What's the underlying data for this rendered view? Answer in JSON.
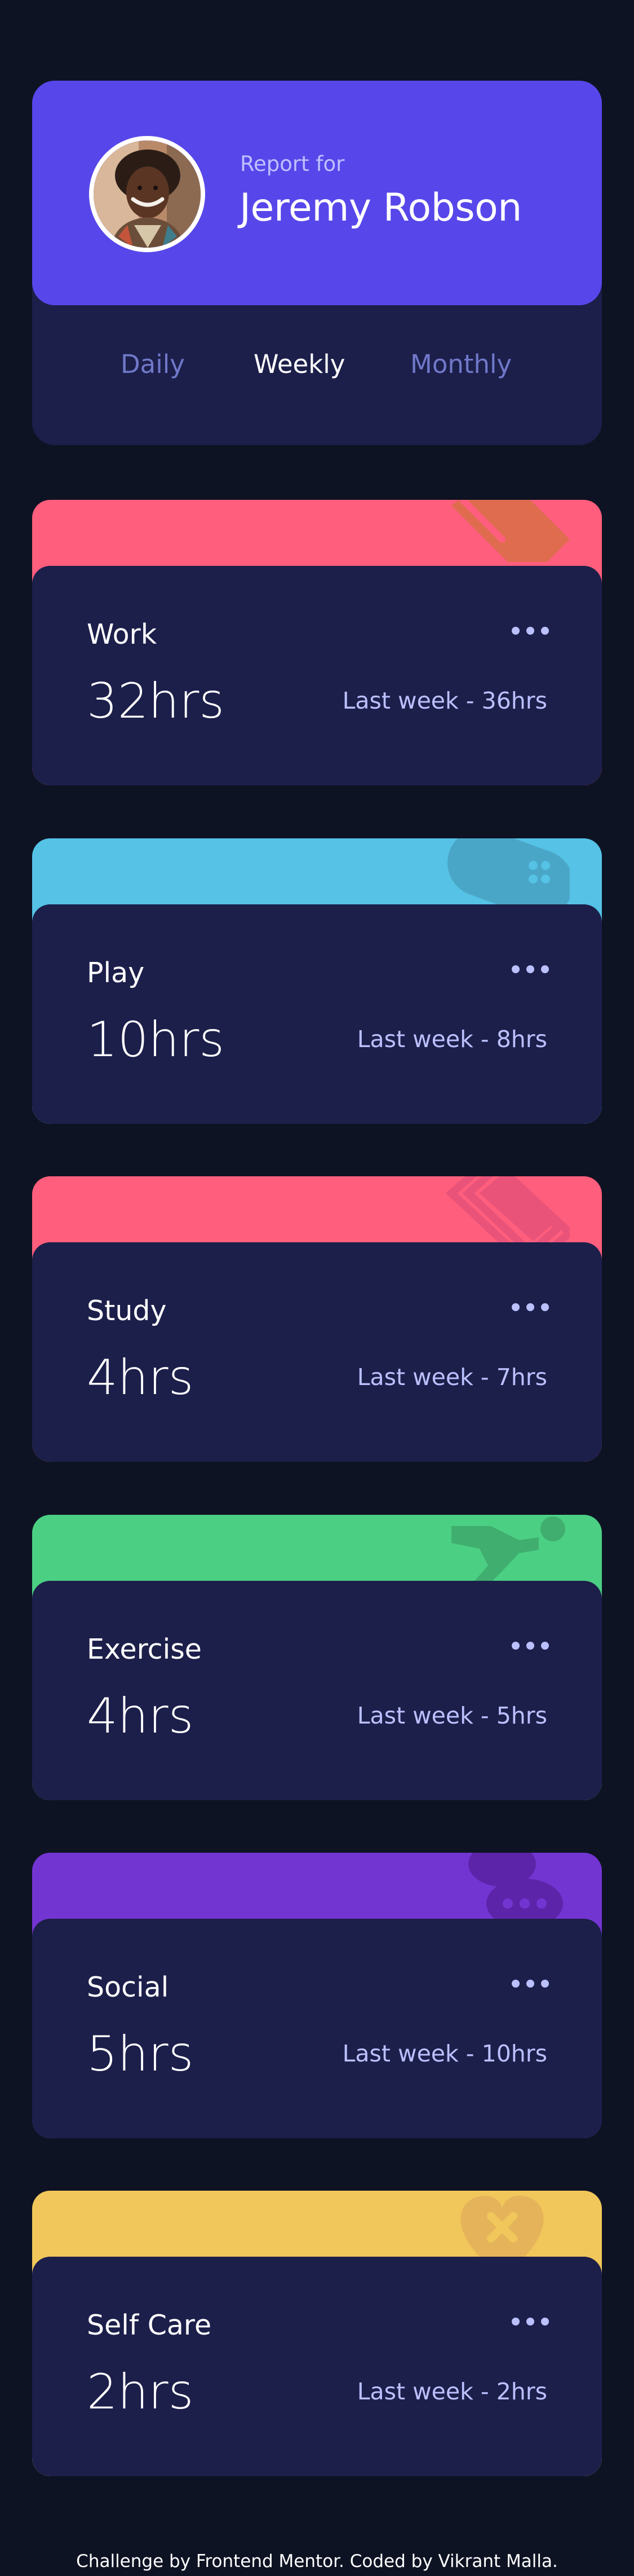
{
  "profile": {
    "report_label": "Report for",
    "name": "Jeremy Robson"
  },
  "tabs": [
    {
      "label": "Daily",
      "active": false
    },
    {
      "label": "Weekly",
      "active": true
    },
    {
      "label": "Monthly",
      "active": false
    }
  ],
  "activities": [
    {
      "title": "Work",
      "current": "32hrs",
      "previous": "Last week - 36hrs",
      "color": "#ff5e7c",
      "icon": "briefcase-icon"
    },
    {
      "title": "Play",
      "current": "10hrs",
      "previous": "Last week - 8hrs",
      "color": "#55c2e6",
      "icon": "gamepad-icon"
    },
    {
      "title": "Study",
      "current": "4hrs",
      "previous": "Last week - 7hrs",
      "color": "#ff5e7c",
      "icon": "book-icon"
    },
    {
      "title": "Exercise",
      "current": "4hrs",
      "previous": "Last week - 5hrs",
      "color": "#4bcf83",
      "icon": "running-icon"
    },
    {
      "title": "Social",
      "current": "5hrs",
      "previous": "Last week - 10hrs",
      "color": "#7335d2",
      "icon": "chat-icon"
    },
    {
      "title": "Self Care",
      "current": "2hrs",
      "previous": "Last week - 2hrs",
      "color": "#f1c75b",
      "icon": "heart-icon"
    }
  ],
  "footer": {
    "text": "Challenge by Frontend Mentor. Coded by Vikrant Malla."
  }
}
